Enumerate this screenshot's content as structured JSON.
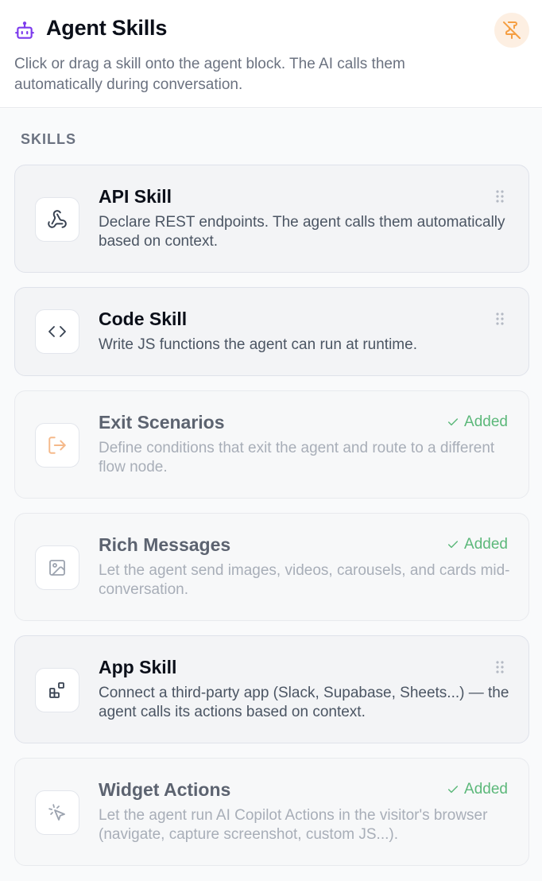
{
  "header": {
    "title": "Agent Skills",
    "description": "Click or drag a skill onto the agent block. The AI calls them automatically during conversation.",
    "title_icon": "robot-icon",
    "unpin_icon": "pin-off-icon",
    "accent_color": "#7c3aed",
    "unpin_color": "#f59e42"
  },
  "section": {
    "title": "SKILLS"
  },
  "skills": [
    {
      "title": "API Skill",
      "description": "Declare REST endpoints. The agent calls them automatically based on context.",
      "icon": "webhook-icon",
      "status": "available"
    },
    {
      "title": "Code Skill",
      "description": "Write JS functions the agent can run at runtime.",
      "icon": "code-icon",
      "status": "available"
    },
    {
      "title": "Exit Scenarios",
      "description": "Define conditions that exit the agent and route to a different flow node.",
      "icon": "exit-icon",
      "status": "added",
      "badge": "Added"
    },
    {
      "title": "Rich Messages",
      "description": "Let the agent send images, videos, carousels, and cards mid-conversation.",
      "icon": "image-icon",
      "status": "added",
      "badge": "Added"
    },
    {
      "title": "App Skill",
      "description": "Connect a third-party app (Slack, Supabase, Sheets...) — the agent calls its actions based on context.",
      "icon": "apps-icon",
      "status": "available"
    },
    {
      "title": "Widget Actions",
      "description": "Let the agent run AI Copilot Actions in the visitor's browser (navigate, capture screenshot, custom JS...).",
      "icon": "cursor-click-icon",
      "status": "added",
      "badge": "Added"
    }
  ]
}
